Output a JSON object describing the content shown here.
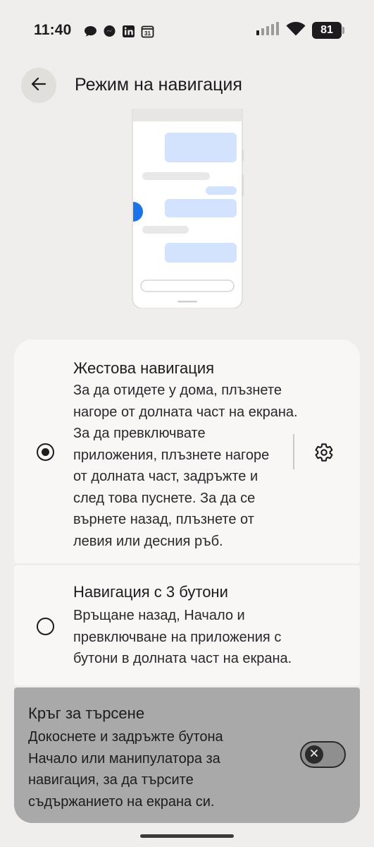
{
  "status_bar": {
    "time": "11:40",
    "battery": "81",
    "notification_icons": [
      "chat-bubble-icon",
      "messenger-icon",
      "linkedin-icon",
      "calendar-icon"
    ],
    "calendar_day": "31"
  },
  "header": {
    "title": "Режим на навигация"
  },
  "options": {
    "gesture": {
      "title": "Жестова навигация",
      "lines": [
        "За да отидете у дома, плъзнете",
        "нагоре от долната част на екрана.",
        "За да превключвате",
        "приложения, плъзнете нагоре",
        "от долната част, задръжте и",
        "след това пуснете. За да се",
        "върнете назад, плъзнете от",
        "левия или десния ръб."
      ],
      "selected": true
    },
    "three_button": {
      "title": "Навигация с 3 бутони",
      "lines": [
        "Връщане назад, Начало и",
        "превключване на приложения с",
        "бутони в долната част на екрана."
      ],
      "selected": false
    }
  },
  "circle_to_search": {
    "title": "Кръг за търсене",
    "lines": [
      "Докоснете и задръжте бутона",
      "Начало или манипулатора за",
      "навигация, за да търсите",
      "съдържанието на екрана си."
    ],
    "enabled": false
  },
  "colors": {
    "accent_blue": "#1a73e8",
    "bubble_blue": "#d3e3fd",
    "card_bg": "#f8f7f5",
    "disabled_card": "#a9a9a9",
    "page_bg": "#efeeec"
  }
}
